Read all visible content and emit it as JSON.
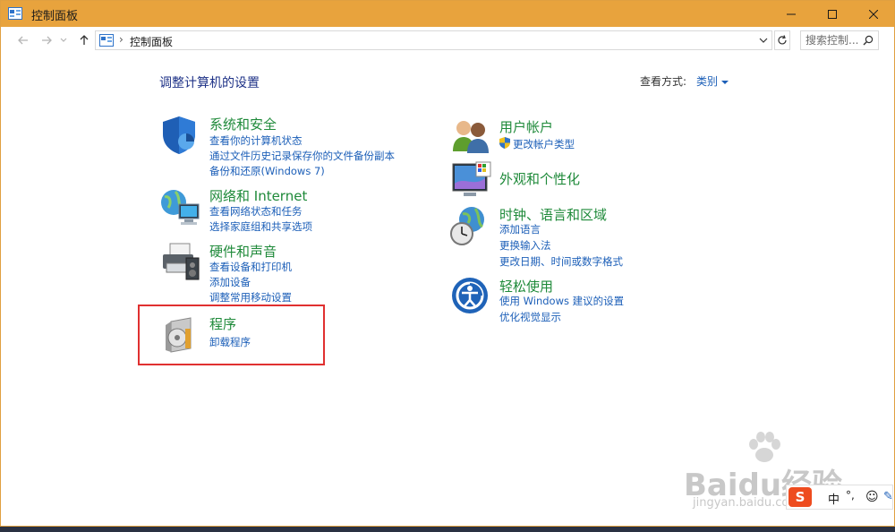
{
  "window": {
    "title": "控制面板",
    "buttons": {
      "minimize": "minimize-icon",
      "maximize": "maximize-icon",
      "close": "close-icon"
    },
    "accent_color": "#e8a33d"
  },
  "addressbar": {
    "crumb_separator": "›",
    "crumb": "控制面板",
    "search_placeholder": "搜索控制..."
  },
  "main": {
    "heading": "调整计算机的设置",
    "view_by_label": "查看方式:",
    "view_by_value": "类别",
    "left_categories": [
      {
        "title": "系统和安全",
        "icon": "shield-icon",
        "links": [
          "查看你的计算机状态",
          "通过文件历史记录保存你的文件备份副本",
          "备份和还原(Windows 7)"
        ]
      },
      {
        "title": "网络和 Internet",
        "icon": "network-globe-icon",
        "links": [
          "查看网络状态和任务",
          "选择家庭组和共享选项"
        ]
      },
      {
        "title": "硬件和声音",
        "icon": "printer-icon",
        "links": [
          "查看设备和打印机",
          "添加设备",
          "调整常用移动设置"
        ]
      },
      {
        "title": "程序",
        "icon": "programs-disc-icon",
        "links": [
          "卸载程序"
        ]
      }
    ],
    "right_categories": [
      {
        "title": "用户帐户",
        "icon": "users-icon",
        "links": [
          "更改帐户类型"
        ]
      },
      {
        "title": "外观和个性化",
        "icon": "monitor-palette-icon",
        "links": []
      },
      {
        "title": "时钟、语言和区域",
        "icon": "clock-globe-icon",
        "links": [
          "添加语言",
          "更换输入法",
          "更改日期、时间或数字格式"
        ]
      },
      {
        "title": "轻松使用",
        "icon": "ease-of-access-icon",
        "links": [
          "使用 Windows 建议的设置",
          "优化视觉显示"
        ]
      }
    ],
    "title_color": "#1f8a3a",
    "link_color": "#1c5fb8",
    "highlight_color": "#e03030"
  },
  "overlay": {
    "watermark_logo": "Baidu经验",
    "watermark_url": "jingyan.baidu.com",
    "ime": {
      "logo": "S",
      "lang": "中",
      "punct": "°,",
      "emoji": "☺",
      "pen": "✎"
    }
  }
}
